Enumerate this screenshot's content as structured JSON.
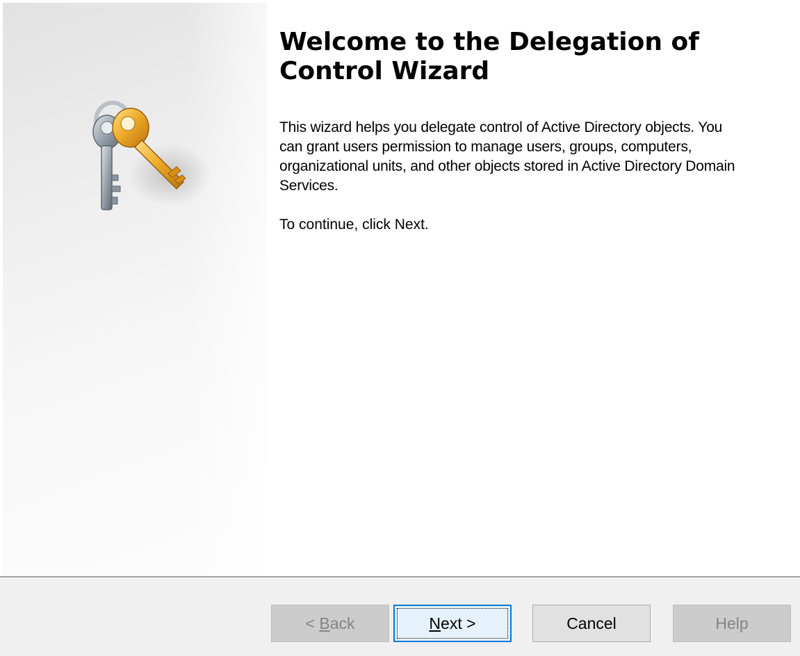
{
  "wizard": {
    "title": "Welcome to the Delegation of Control Wizard",
    "description": "This wizard helps you delegate control of Active Directory objects. You can grant users permission to manage users, groups, computers, organizational units, and other objects stored in Active Directory Domain Services.",
    "continue_text": "To continue, click Next.",
    "side_icon": "keys-icon"
  },
  "buttons": {
    "back": {
      "prefix": "< ",
      "accel": "B",
      "rest": "ack",
      "enabled": false
    },
    "next": {
      "accel": "N",
      "rest": "ext >",
      "enabled": true
    },
    "cancel": {
      "label": "Cancel",
      "enabled": true
    },
    "help": {
      "label": "Help",
      "enabled": false
    }
  },
  "colors": {
    "default_button_border": "#0078d7",
    "key_gold": "#e8a21c",
    "key_silver": "#9aa3ad"
  }
}
